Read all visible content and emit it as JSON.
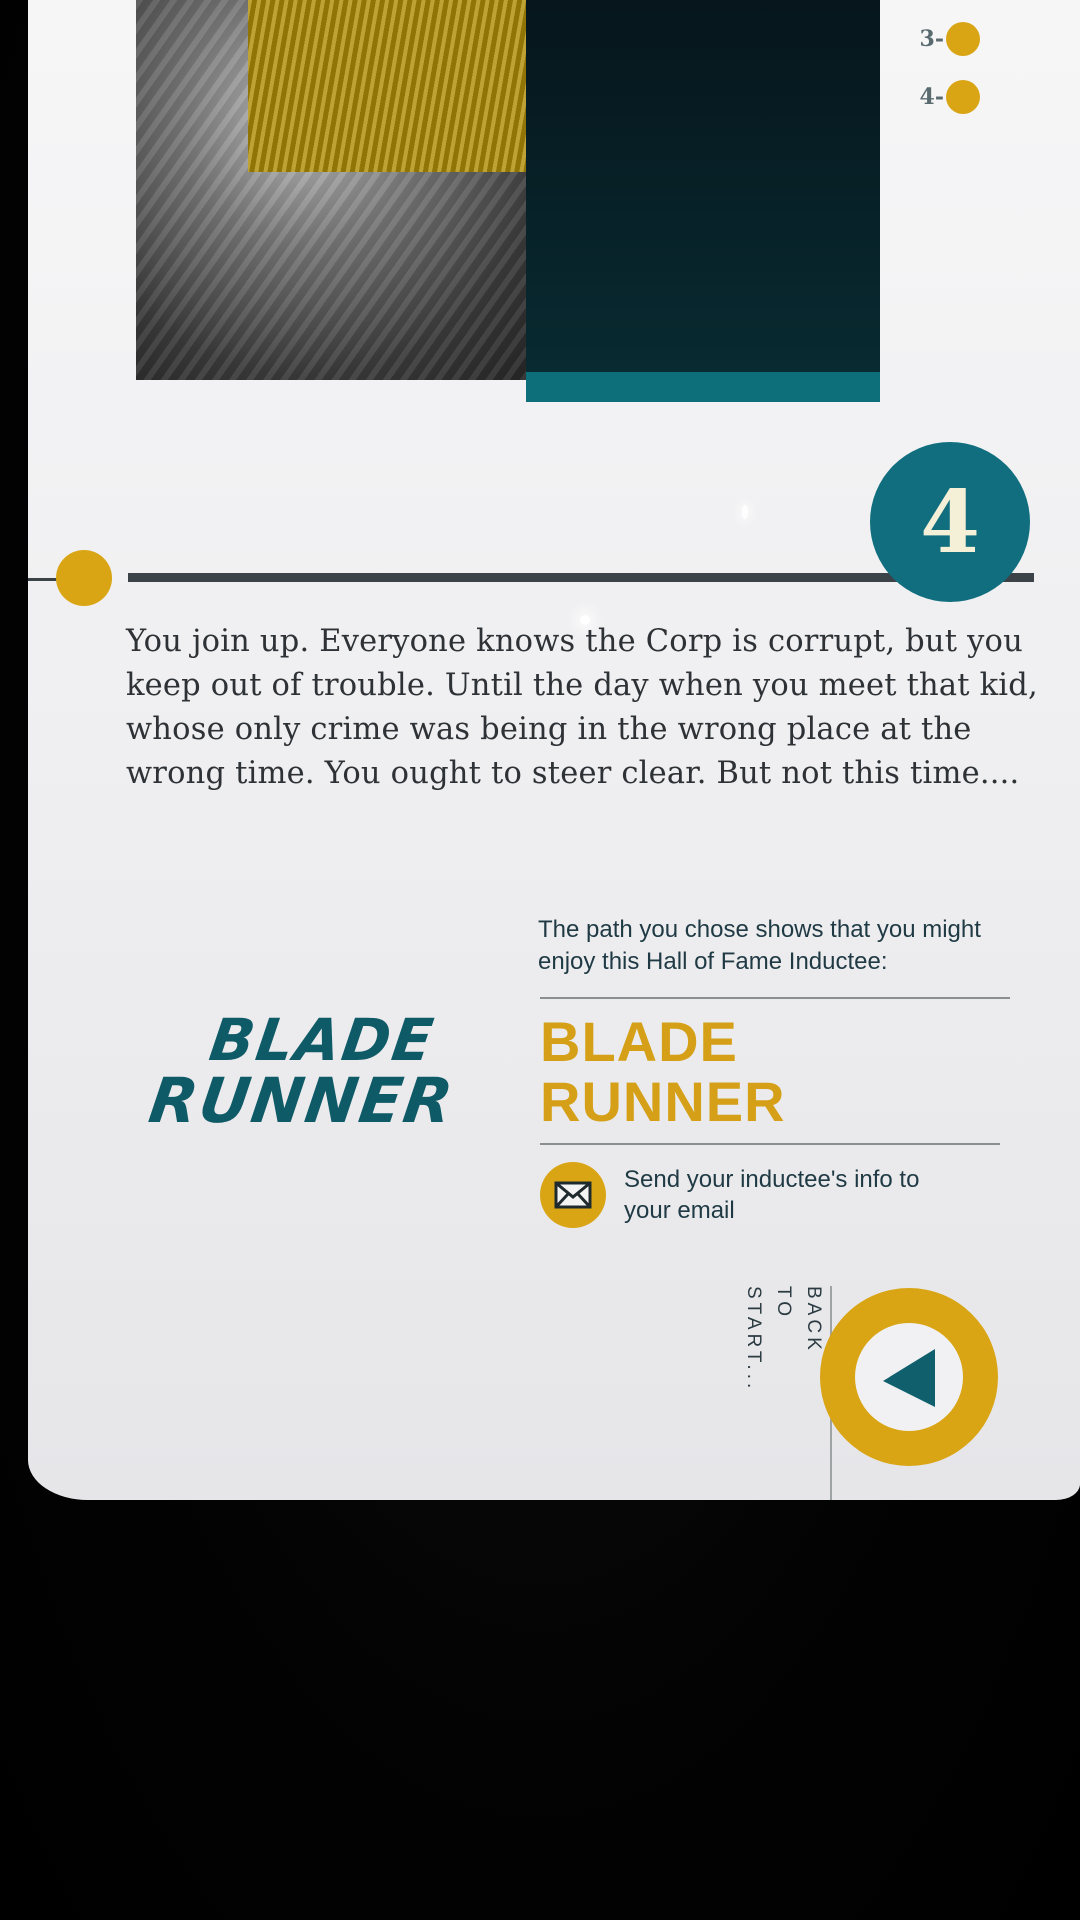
{
  "progress": {
    "steps": [
      {
        "label": "3-"
      },
      {
        "label": "4-"
      }
    ]
  },
  "step": {
    "number": "4"
  },
  "story": {
    "text": "You join up. Everyone knows the Corp is corrupt, but you keep out of trouble. Until the day when you meet that kid, whose only crime was being in the wrong place at the wrong time. You ought to steer clear. But not this time...."
  },
  "recommendation": {
    "intro": "The path you chose shows that you might enjoy this Hall of Fame Inductee:",
    "logo_line1": "BLADE",
    "logo_line2": "RUNNER",
    "title_line1": "BLADE",
    "title_line2": "RUNNER"
  },
  "email": {
    "label": "Send your inductee's info to your email",
    "icon": "envelope-icon"
  },
  "back": {
    "words": [
      "BACK",
      "TO",
      "START..."
    ],
    "icon": "triangle-left-icon"
  },
  "colors": {
    "accent_yellow": "#d9a514",
    "accent_teal": "#106e7e",
    "text_dark": "#2e3236"
  }
}
